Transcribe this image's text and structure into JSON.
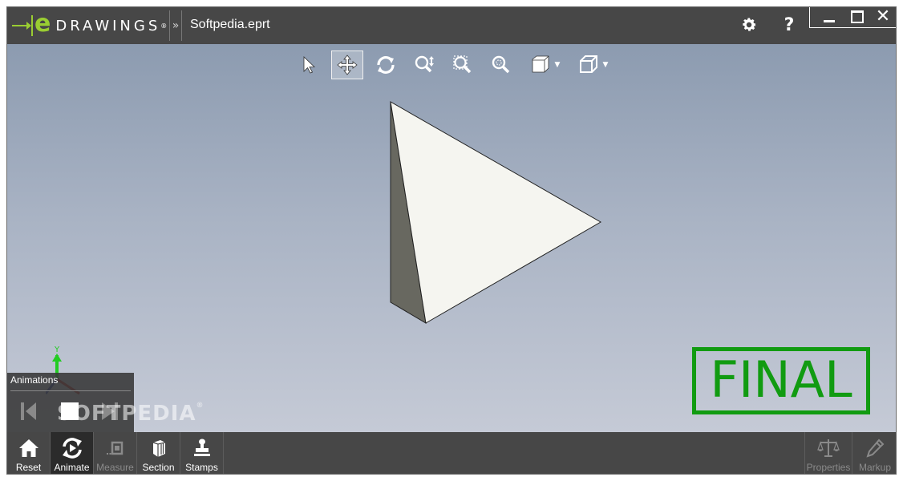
{
  "app": {
    "logo_e": "e",
    "logo_text": "DRAWINGS",
    "logo_reg": "®",
    "overflow_glyph": "»",
    "file_name": "Softpedia.eprt"
  },
  "titlebar": {
    "help_label": "?",
    "close_glyph": "✕",
    "icons": [
      "gear-icon",
      "minimize-icon",
      "maximize-icon",
      "close-icon"
    ]
  },
  "toolbar": {
    "tools": [
      "select-icon",
      "pan-icon",
      "rotate-icon",
      "zoom-icon",
      "zoom-to-fit-icon",
      "zoom-to-area-icon",
      "views-icon",
      "display-style-icon"
    ],
    "active_tool": "pan"
  },
  "viewport": {
    "stamp_text": "FINAL",
    "stamp_color": "#119b11",
    "axis_label": "Y",
    "watermark": "SOFTPEDIA",
    "watermark_reg": "®"
  },
  "animations_panel": {
    "title": "Animations"
  },
  "bottombar": {
    "items": [
      {
        "label": "Reset",
        "state": "normal"
      },
      {
        "label": "Animate",
        "state": "active"
      },
      {
        "label": "Measure",
        "state": "disabled"
      },
      {
        "label": "Section",
        "state": "normal"
      },
      {
        "label": "Stamps",
        "state": "normal"
      }
    ],
    "right_items": [
      {
        "label": "Properties",
        "state": "disabled"
      },
      {
        "label": "Markup",
        "state": "disabled"
      }
    ]
  },
  "colors": {
    "chrome": "#474747",
    "brand_green": "#9acd32",
    "model_face": "#f5f5f0",
    "model_side": "#686860"
  }
}
